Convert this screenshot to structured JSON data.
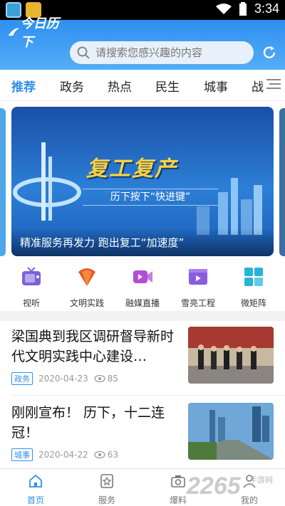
{
  "status_bar": {
    "time": "3:34"
  },
  "header": {
    "logo_text": "今日历下",
    "search_placeholder": "请搜索您感兴趣的内容"
  },
  "tabs": [
    "推荐",
    "政务",
    "热点",
    "民生",
    "城事",
    "战"
  ],
  "active_tab": 0,
  "banner": {
    "headline": "复工复产",
    "subline": "历下按下“快进键”",
    "caption": "精准服务再发力 跑出复工“加速度”"
  },
  "quick_links": [
    {
      "label": "视听",
      "icon": "tv-icon",
      "color": "#7b62d8"
    },
    {
      "label": "文明实践",
      "icon": "fan-icon",
      "color": "#e4562c"
    },
    {
      "label": "融媒直播",
      "icon": "video-icon",
      "color": "#b04ed6"
    },
    {
      "label": "雪亮工程",
      "icon": "film-icon",
      "color": "#8a5be0"
    },
    {
      "label": "微矩阵",
      "icon": "grid-icon",
      "color": "#27b3d8"
    }
  ],
  "news": [
    {
      "title": "梁国典到我区调研督导新时代文明实践中心建设…",
      "tag": "政务",
      "date": "2020-04-23",
      "views": "85"
    },
    {
      "title": "刚刚宣布！ 历下，十二连冠！",
      "tag": "城事",
      "date": "2020-04-22",
      "views": "63"
    }
  ],
  "bottom_nav": [
    {
      "label": "首页",
      "icon": "home-icon"
    },
    {
      "label": "服务",
      "icon": "star-doc-icon"
    },
    {
      "label": "爆料",
      "icon": "camera-icon"
    },
    {
      "label": "我的",
      "icon": "user-icon"
    }
  ],
  "watermark": {
    "main": "2265",
    "sub": "手游网"
  },
  "colors": {
    "brand": "#2f8ff0"
  }
}
